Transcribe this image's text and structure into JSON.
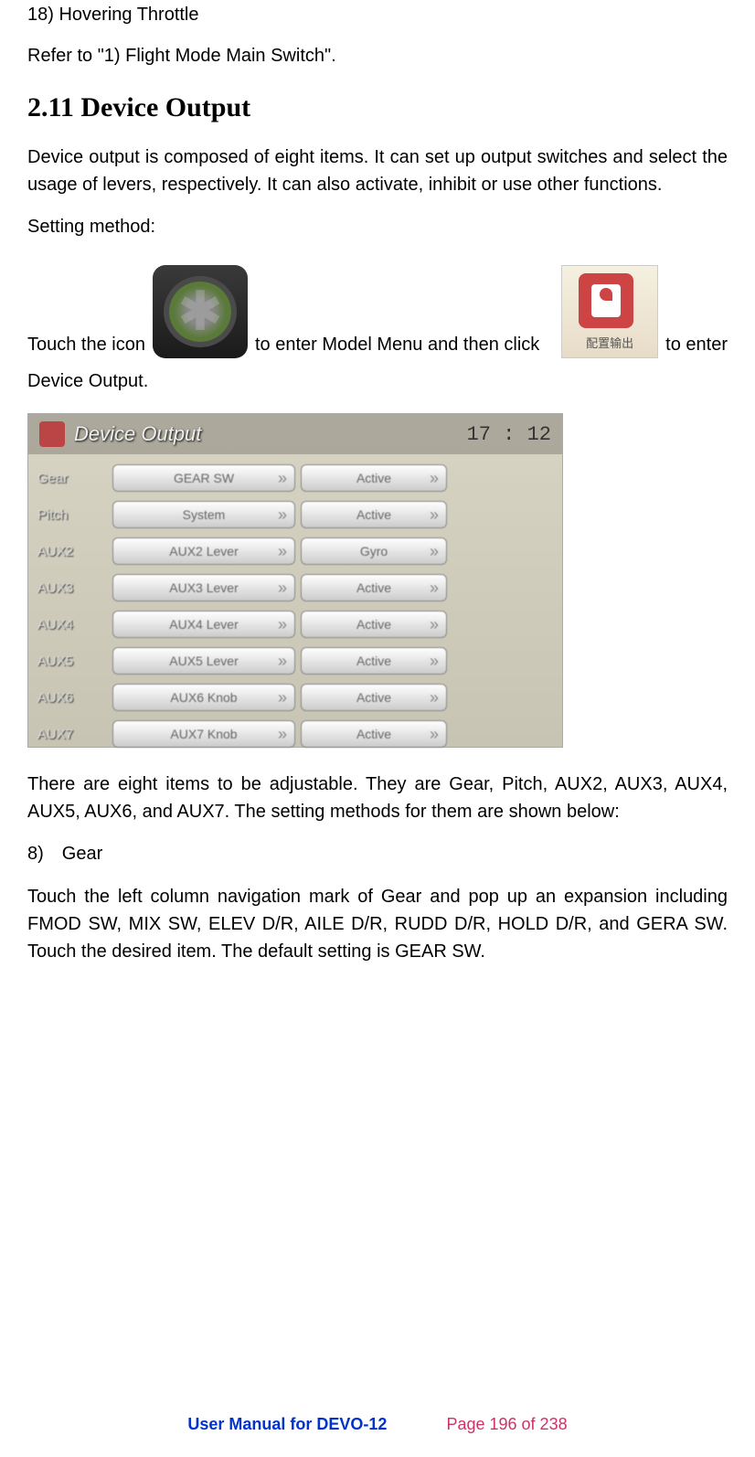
{
  "heading18": "18) Hovering Throttle",
  "referText": "Refer to \"1) Flight Mode Main Switch\".",
  "sectionHeading": "2.11 Device Output",
  "intro": "Device output is composed of eight items. It can set up output switches and select the usage of levers, respectively. It can also activate, inhibit or use other functions.",
  "settingMethod": "Setting method:",
  "iconLine": {
    "p1": "Touch the icon",
    "p2": "to enter Model Menu and then click",
    "p3": "to enter",
    "p4": "Device Output."
  },
  "screenshot": {
    "title": "Device Output",
    "time": "17 : 12",
    "rows": [
      {
        "label": "Gear",
        "left": "GEAR SW",
        "right": "Active"
      },
      {
        "label": "Pitch",
        "left": "System",
        "right": "Active"
      },
      {
        "label": "AUX2",
        "left": "AUX2 Lever",
        "right": "Gyro"
      },
      {
        "label": "AUX3",
        "left": "AUX3 Lever",
        "right": "Active"
      },
      {
        "label": "AUX4",
        "left": "AUX4 Lever",
        "right": "Active"
      },
      {
        "label": "AUX5",
        "left": "AUX5 Lever",
        "right": "Active"
      },
      {
        "label": "AUX6",
        "left": "AUX6 Knob",
        "right": "Active"
      },
      {
        "label": "AUX7",
        "left": "AUX7 Knob",
        "right": "Active"
      }
    ]
  },
  "eightItems": "There are eight items to be adjustable. They are Gear, Pitch, AUX2, AUX3, AUX4, AUX5, AUX6, and AUX7. The setting methods for them are shown below:",
  "section8": "8) Gear",
  "gearText": "Touch the left column navigation mark of Gear and pop up an expansion including FMOD SW, MIX SW, ELEV D/R, AILE D/R, RUDD D/R, HOLD D/R, and GERA SW. Touch the desired item. The default setting is GEAR SW.",
  "footer": {
    "manual": "User Manual for DEVO-12",
    "page": "Page 196 of 238"
  }
}
